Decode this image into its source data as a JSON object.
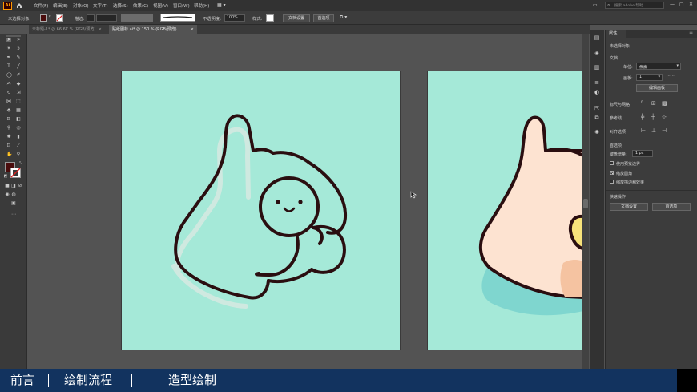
{
  "app": {
    "logo": "Ai"
  },
  "menu": {
    "items": [
      "文件(F)",
      "编辑(E)",
      "对象(O)",
      "文字(T)",
      "选择(S)",
      "效果(C)",
      "视图(V)",
      "窗口(W)",
      "帮助(H)"
    ],
    "search_placeholder": "搜索 adobe 帮助"
  },
  "control_bar": {
    "selection_label": "未选择对象",
    "stroke_label": "描边:",
    "opacity_label": "不透明度:",
    "opacity_value": "100%",
    "style_label": "样式:",
    "doc_setup_label": "文档设置",
    "preferences_label": "首选项"
  },
  "tabs": [
    {
      "label": "未标题-1* @ 66.67 % (RGB/预览)",
      "active": false
    },
    {
      "label": "贴纸图标.ai* @ 150 % (RGB/预览)",
      "active": true
    }
  ],
  "panel": {
    "tab": "属性",
    "no_selection": "未选择对象",
    "document_heading": "文档",
    "units_label": "单位:",
    "units_value": "像素",
    "artboard_label": "画板:",
    "artboard_value": "1",
    "edit_artboards_label": "编辑画板",
    "rulers_grids_label": "标尺与网格",
    "guides_label": "参考线",
    "align_options_label": "对齐选项",
    "preferences_heading": "首选项",
    "keyboard_increment_label": "键盘增量:",
    "keyboard_increment_value": "1 px",
    "checkboxes": [
      {
        "label": "使用预览边界",
        "checked": false
      },
      {
        "label": "缩放圆角",
        "checked": true
      },
      {
        "label": "缩放描边和效果",
        "checked": false
      }
    ],
    "quick_actions_heading": "快速操作",
    "doc_setup_button": "文档设置",
    "preferences_button": "首选项"
  },
  "colors": {
    "artboard": "#a5e9d8",
    "outline": "#2a0e10",
    "hand_fill": "#fde3d1",
    "hand_shadow": "#f5c3a1",
    "coin": "#f7e27a",
    "bottom_bar": "#12335f",
    "fill_swatch": "#4a0c0c"
  },
  "bottom_nav": {
    "items": [
      "前言",
      "绘制流程",
      "造型绘制"
    ]
  }
}
